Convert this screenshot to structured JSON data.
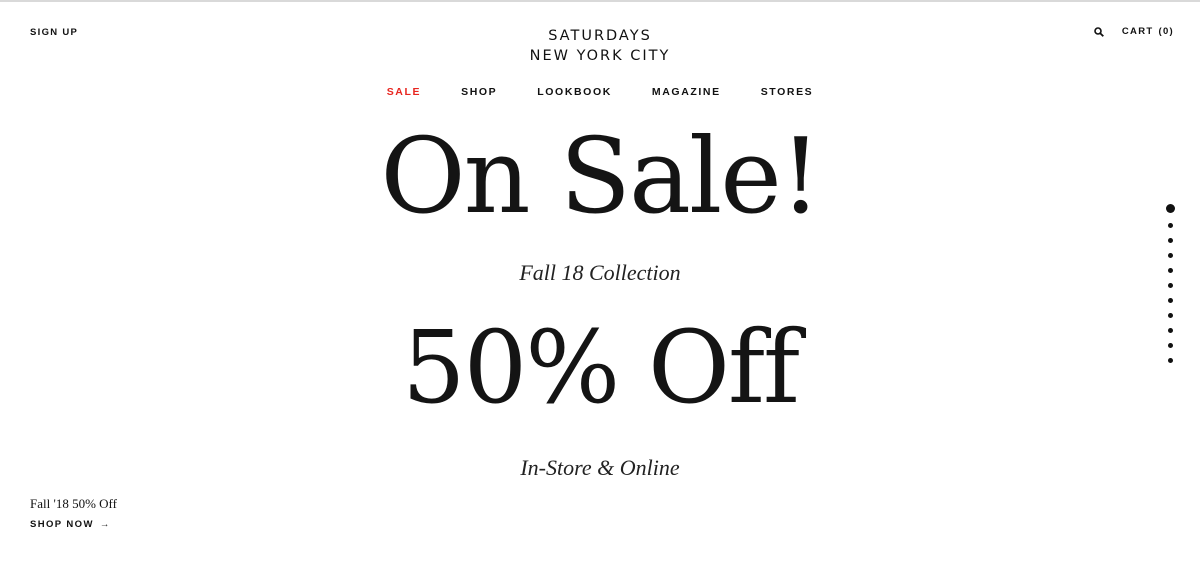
{
  "header": {
    "sign_up": "SIGN UP",
    "brand_line1": "SATURDAYS",
    "brand_line2": "NEW YORK CITY",
    "search_icon": "search-icon",
    "cart_label": "CART",
    "cart_count": "(0)"
  },
  "nav": {
    "items": [
      {
        "label": "SALE",
        "color": "#e8251f"
      },
      {
        "label": "SHOP"
      },
      {
        "label": "LOOKBOOK"
      },
      {
        "label": "MAGAZINE"
      },
      {
        "label": "STORES"
      }
    ]
  },
  "hero": {
    "headline1": "On Sale!",
    "sub1": "Fall 18 Collection",
    "headline2": "50% Off",
    "sub2": "In-Store & Online"
  },
  "promo": {
    "title": "Fall '18 50% Off",
    "link_label": "SHOP NOW",
    "link_arrow": "→"
  },
  "slider": {
    "total": 11,
    "active_index": 0
  }
}
